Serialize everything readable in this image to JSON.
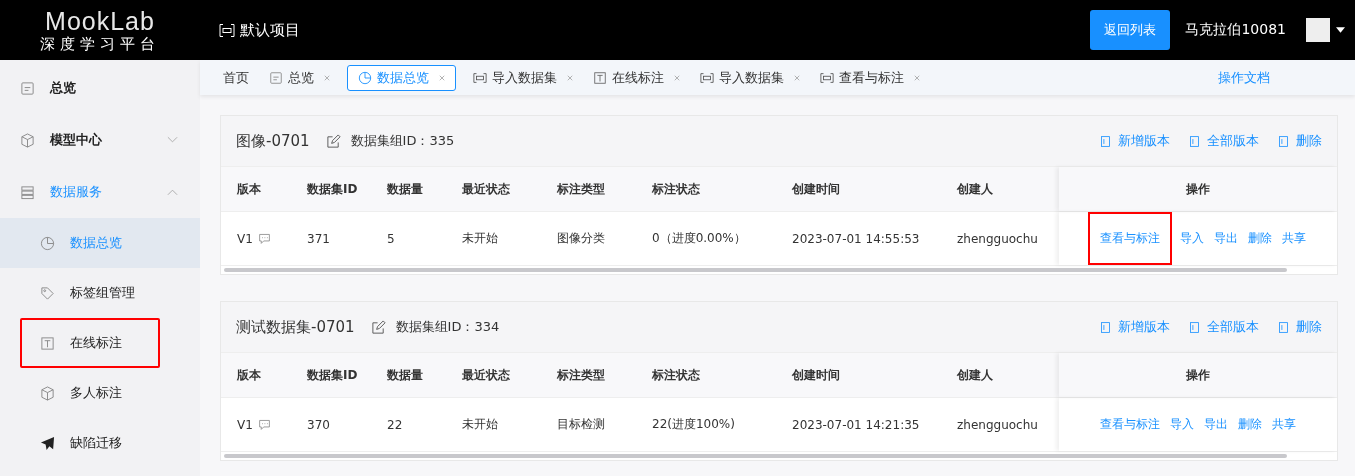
{
  "header": {
    "logo_title": "MookLab",
    "logo_subtitle": "深度学习平台",
    "project": "默认项目",
    "back_button": "返回列表",
    "user": "马克拉伯10081"
  },
  "sidebar": {
    "items": [
      {
        "kind": "doc",
        "label": "总览",
        "selected": false
      },
      {
        "kind": "cube",
        "label": "模型中心",
        "expanded": false,
        "selected": false
      },
      {
        "kind": "db",
        "label": "数据服务",
        "expanded": true,
        "selected": true,
        "children": [
          {
            "kind": "pie",
            "label": "数据总览",
            "selected": true,
            "highlighted": false
          },
          {
            "kind": "tag",
            "label": "标签组管理",
            "selected": false,
            "highlighted": false
          },
          {
            "kind": "text",
            "label": "在线标注",
            "selected": false,
            "highlighted": true
          },
          {
            "kind": "cube",
            "label": "多人标注",
            "selected": false,
            "highlighted": false
          },
          {
            "kind": "plane",
            "label": "缺陷迁移",
            "selected": false,
            "highlighted": false
          }
        ]
      }
    ]
  },
  "tabs": [
    {
      "kind": "home",
      "label": "首页",
      "selected": false
    },
    {
      "kind": "doc",
      "label": "总览",
      "selected": false
    },
    {
      "kind": "pie",
      "label": "数据总览",
      "selected": true
    },
    {
      "kind": "frame",
      "label": "导入数据集",
      "selected": false
    },
    {
      "kind": "text",
      "label": "在线标注",
      "selected": false
    },
    {
      "kind": "frame",
      "label": "导入数据集",
      "selected": false
    },
    {
      "kind": "frame",
      "label": "查看与标注",
      "selected": false
    }
  ],
  "docs_link": "操作文档",
  "datasets": [
    {
      "name": "图像-0701",
      "group_id": "数据集组ID：335",
      "actions": [
        "新增版本",
        "全部版本",
        "删除"
      ],
      "columns": [
        "版本",
        "数据集ID",
        "数据量",
        "最近状态",
        "标注类型",
        "标注状态",
        "创建时间",
        "创建人",
        "操作"
      ],
      "rows": [
        {
          "version": "V1",
          "id": "371",
          "count": "5",
          "status": "未开始",
          "type": "图像分类",
          "progress": "0（进度0.00%）",
          "created": "2023-07-01 14:55:53",
          "creator": "zhengguochu",
          "ops": [
            {
              "label": "查看与标注",
              "highlighted": true
            },
            {
              "label": "导入",
              "highlighted": false
            },
            {
              "label": "导出",
              "highlighted": false
            },
            {
              "label": "删除",
              "highlighted": false
            },
            {
              "label": "共享",
              "highlighted": false
            }
          ]
        }
      ]
    },
    {
      "name": "测试数据集-0701",
      "group_id": "数据集组ID：334",
      "actions": [
        "新增版本",
        "全部版本",
        "删除"
      ],
      "columns": [
        "版本",
        "数据集ID",
        "数据量",
        "最近状态",
        "标注类型",
        "标注状态",
        "创建时间",
        "创建人",
        "操作"
      ],
      "rows": [
        {
          "version": "V1",
          "id": "370",
          "count": "22",
          "status": "未开始",
          "type": "目标检测",
          "progress": "22(进度100%)",
          "created": "2023-07-01 14:21:35",
          "creator": "zhengguochu",
          "ops": [
            {
              "label": "查看与标注",
              "highlighted": false
            },
            {
              "label": "导入",
              "highlighted": false
            },
            {
              "label": "导出",
              "highlighted": false
            },
            {
              "label": "删除",
              "highlighted": false
            },
            {
              "label": "共享",
              "highlighted": false
            }
          ]
        }
      ]
    }
  ]
}
